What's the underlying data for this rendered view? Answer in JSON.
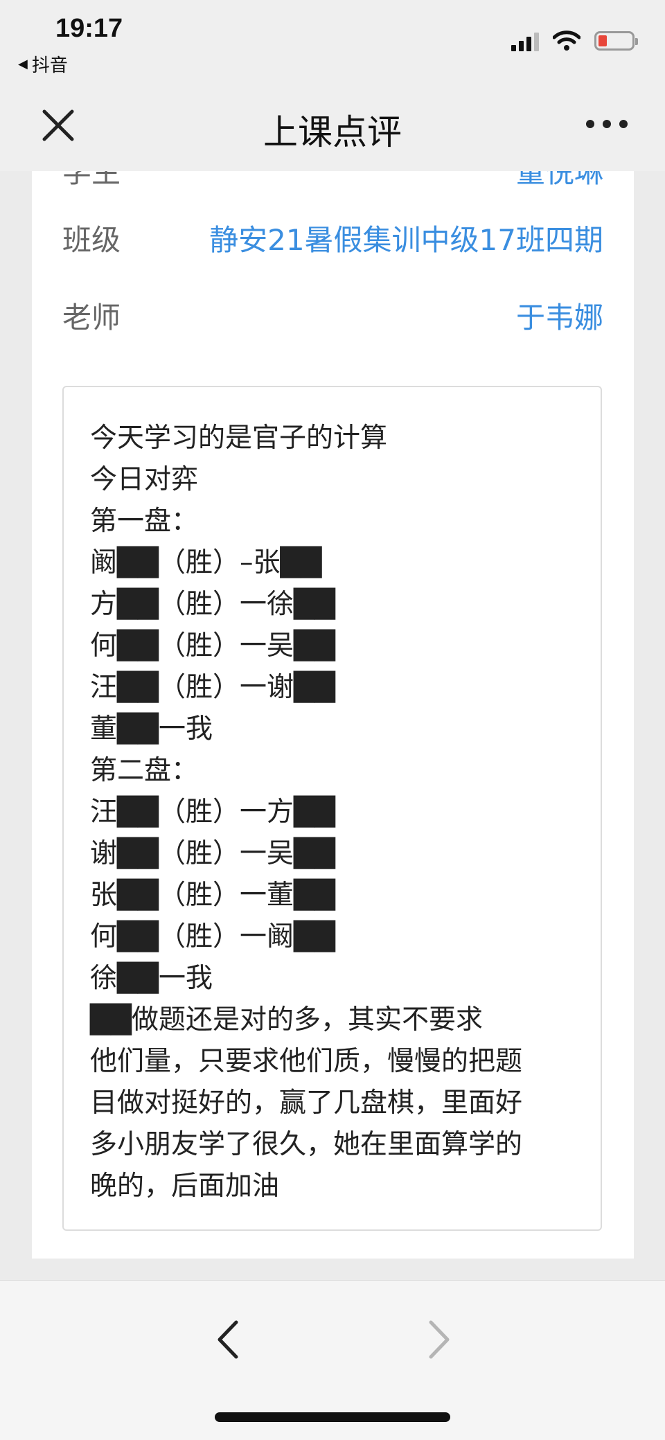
{
  "status_bar": {
    "time": "19:17",
    "back_app": "抖音"
  },
  "nav": {
    "title": "上课点评"
  },
  "partial_row": {
    "label": "学生",
    "value": "董悦琳"
  },
  "info": {
    "class_label": "班级",
    "class_value": "静安21暑假集训中级17班四期",
    "teacher_label": "老师",
    "teacher_value": "于韦娜"
  },
  "comment": {
    "lines": [
      "今天学习的是官子的计算",
      "今日对弈",
      "第一盘：",
      "阚██（胜）–张██",
      "方██（胜）一徐██",
      "何██（胜）一吴██",
      "汪██（胜）一谢██",
      "董██一我",
      "第二盘：",
      "汪██（胜）一方██",
      "谢██（胜）一吴██",
      "张██（胜）一董██",
      "何██（胜）一阚██",
      "徐██一我",
      "██做题还是对的多，其实不要求",
      "他们量，只要求他们质，慢慢的把题",
      "目做对挺好的，赢了几盘棋，里面好",
      "多小朋友学了很久，她在里面算学的",
      "晚的，后面加油"
    ]
  },
  "colors": {
    "accent": "#3a8ee0",
    "label": "#666666",
    "battery_low": "#e8463a"
  },
  "icons": {
    "close": "close-icon",
    "more": "more-icon",
    "back": "chevron-left-icon",
    "forward": "chevron-right-icon"
  }
}
